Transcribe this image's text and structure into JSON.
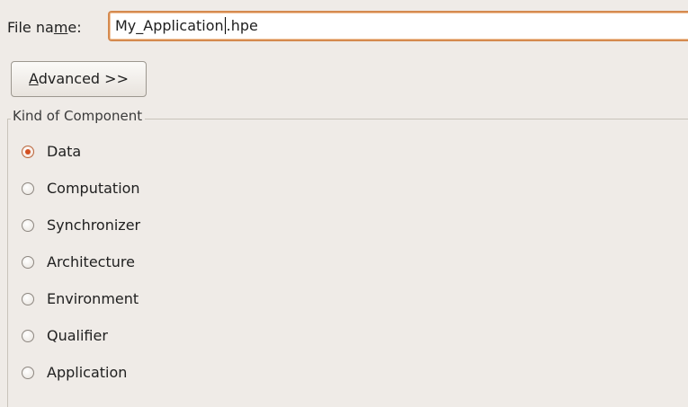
{
  "filename": {
    "label_before": "File na",
    "label_mnemonic": "m",
    "label_after": "e:",
    "value_before_caret": "My_Application",
    "value_after_caret": ".hpe"
  },
  "advanced_button": {
    "mnemonic": "A",
    "label_rest": "dvanced >>"
  },
  "component_kind": {
    "title": "Kind of Component",
    "options": [
      {
        "label": "Data",
        "checked": true
      },
      {
        "label": "Computation",
        "checked": false
      },
      {
        "label": "Synchronizer",
        "checked": false
      },
      {
        "label": "Architecture",
        "checked": false
      },
      {
        "label": "Environment",
        "checked": false
      },
      {
        "label": "Qualifier",
        "checked": false
      },
      {
        "label": "Application",
        "checked": false
      }
    ]
  },
  "colors": {
    "background": "#efebe7",
    "focus_border": "#d58a4f",
    "radio_dot": "#d34f21"
  }
}
